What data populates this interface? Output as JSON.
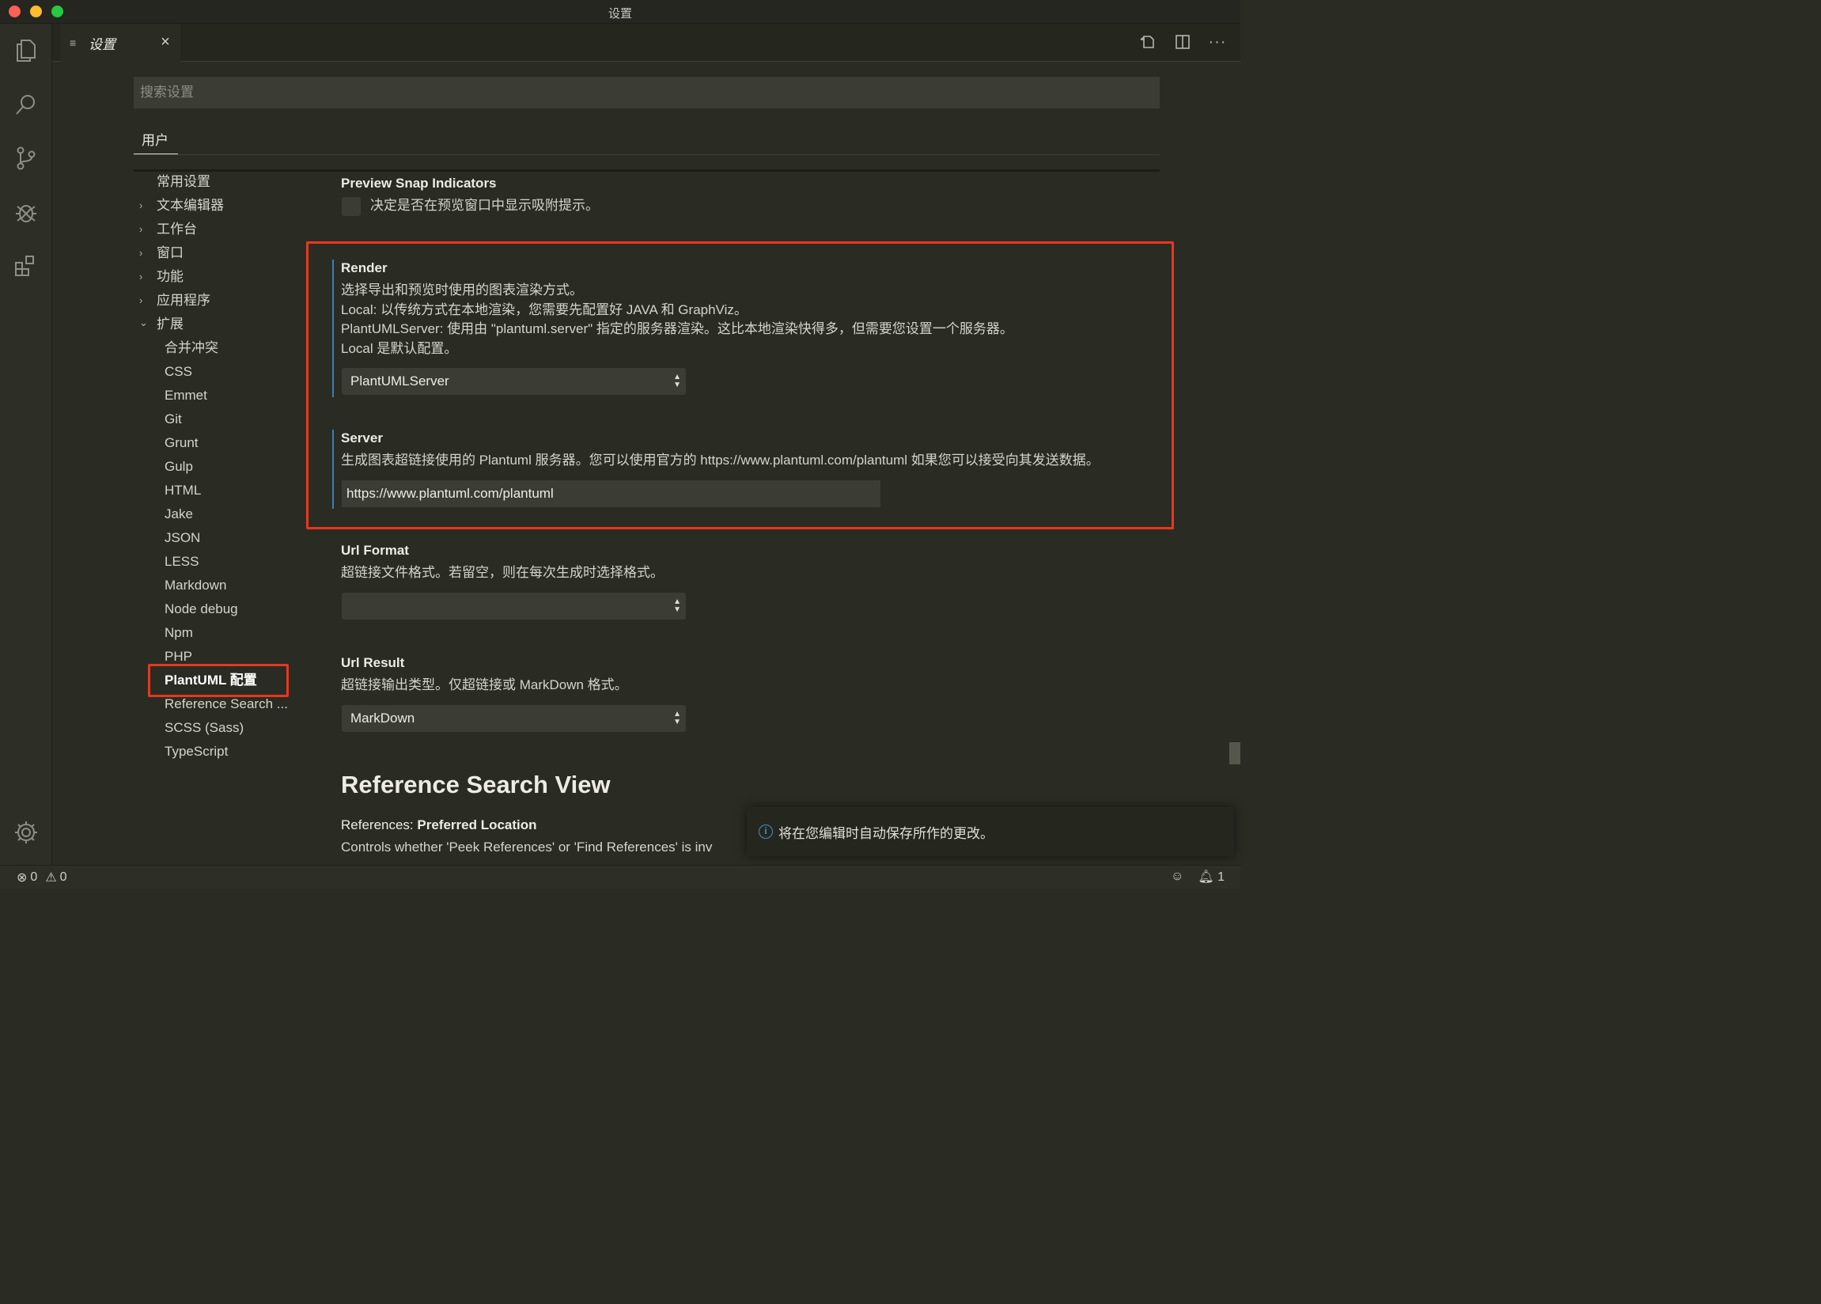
{
  "window": {
    "title": "设置"
  },
  "tab": {
    "label": "设置",
    "icon": "lines-icon",
    "close": "×"
  },
  "search": {
    "placeholder": "搜索设置"
  },
  "scope": {
    "user_tab": "用户"
  },
  "toc": {
    "items": [
      {
        "label": "常用设置",
        "chevron": ""
      },
      {
        "label": "文本编辑器",
        "chevron": "›"
      },
      {
        "label": "工作台",
        "chevron": "›"
      },
      {
        "label": "窗口",
        "chevron": "›"
      },
      {
        "label": "功能",
        "chevron": "›"
      },
      {
        "label": "应用程序",
        "chevron": "›"
      },
      {
        "label": "扩展",
        "chevron": "⌄"
      }
    ],
    "extensions": [
      "合并冲突",
      "CSS",
      "Emmet",
      "Git",
      "Grunt",
      "Gulp",
      "HTML",
      "Jake",
      "JSON",
      "LESS",
      "Markdown",
      "Node debug",
      "Npm",
      "PHP",
      "PlantUML 配置",
      "Reference Search ...",
      "SCSS (Sass)",
      "TypeScript"
    ],
    "active": "PlantUML 配置"
  },
  "settings": {
    "preview_snap": {
      "title": "Preview Snap Indicators",
      "desc": "决定是否在预览窗口中显示吸附提示。",
      "checked": false
    },
    "render": {
      "title": "Render",
      "desc": [
        "选择导出和预览时使用的图表渲染方式。",
        "Local: 以传统方式在本地渲染，您需要先配置好 JAVA 和 GraphViz。",
        "PlantUMLServer: 使用由 \"plantuml.server\" 指定的服务器渲染。这比本地渲染快得多，但需要您设置一个服务器。",
        "Local 是默认配置。"
      ],
      "value": "PlantUMLServer"
    },
    "server": {
      "title": "Server",
      "desc": "生成图表超链接使用的 Plantuml 服务器。您可以使用官方的 https://www.plantuml.com/plantuml 如果您可以接受向其发送数据。",
      "value": "https://www.plantuml.com/plantuml"
    },
    "url_format": {
      "title": "Url Format",
      "desc": "超链接文件格式。若留空，则在每次生成时选择格式。",
      "value": ""
    },
    "url_result": {
      "title": "Url Result",
      "desc": "超链接输出类型。仅超链接或 MarkDown 格式。",
      "value": "MarkDown"
    },
    "section_heading": "Reference Search View",
    "references": {
      "category": "References: ",
      "title": "Preferred Location",
      "desc": "Controls whether 'Peek References' or 'Find References' is inv"
    }
  },
  "notification": {
    "text": "将在您编辑时自动保存所作的更改。",
    "icon": "info-icon"
  },
  "status": {
    "errors": "0",
    "warnings": "0",
    "notifications": "1"
  },
  "colors": {
    "accent_highlight": "#e8371f",
    "modified_indicator": "#3d7eb3"
  }
}
